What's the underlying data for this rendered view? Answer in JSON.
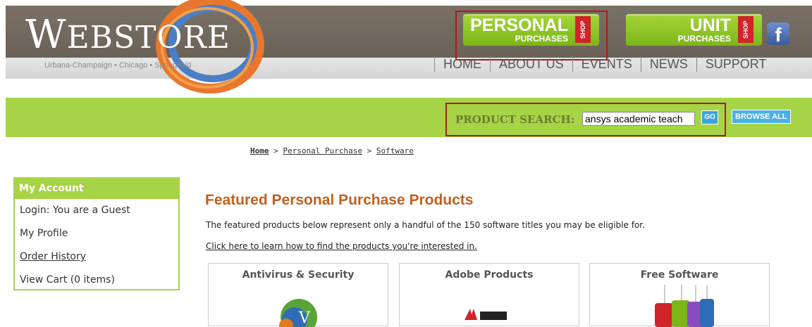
{
  "header": {
    "logo_first": "W",
    "logo_rest": "EBSTORE",
    "logo_tagline": "Urbana-Champaign • Chicago • Springfield",
    "personal": {
      "line1": "PERSONAL",
      "line2": "PURCHASES",
      "tag": "SHOP"
    },
    "unit": {
      "line1": "UNIT",
      "line2": "PURCHASES",
      "tag": "SHOP"
    },
    "facebook": "f"
  },
  "nav": [
    "HOME",
    "ABOUT US",
    "EVENTS",
    "NEWS",
    "SUPPORT"
  ],
  "search": {
    "label": "PRODUCT SEARCH:",
    "value": "ansys academic teach",
    "go_label": "GO",
    "browse_label": "BROWSE ALL"
  },
  "breadcrumb": {
    "home": "Home",
    "sep1": " > ",
    "personal": "Personal Purchase",
    "sep2": " > ",
    "software": "Software"
  },
  "account": {
    "title": "My Account",
    "items": [
      "Login: You are a Guest",
      "My Profile",
      "Order History",
      "View Cart (0 items)"
    ]
  },
  "main": {
    "heading": "Featured Personal Purchase Products",
    "paragraph": "The featured products below represent only a handful of the 150 software titles you may be eligible for.",
    "link": "Click here to learn how to find the products you're interested in.",
    "cards": [
      "Antivirus & Security",
      "Adobe Products",
      "Free Software"
    ]
  },
  "colors": {
    "green": "#a7d447",
    "orange_heading": "#c1601e",
    "highlight_red": "#b0181c"
  }
}
